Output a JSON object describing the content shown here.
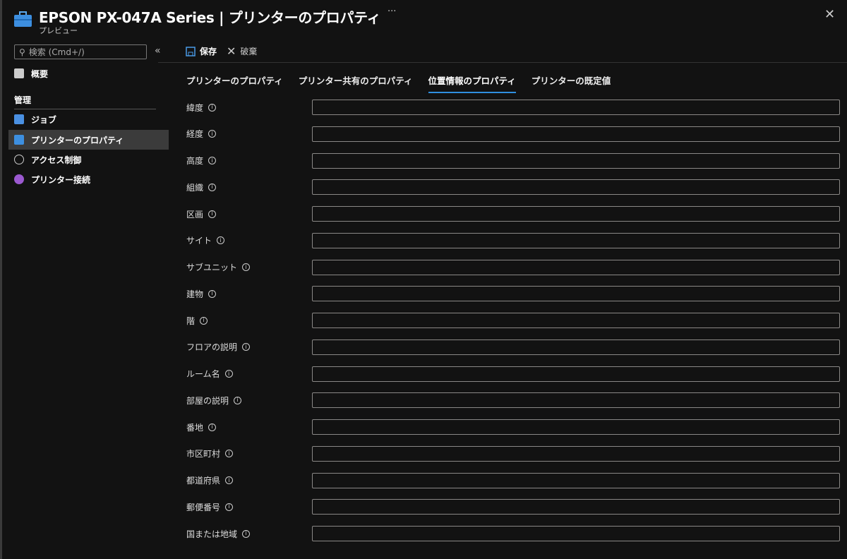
{
  "header": {
    "title": "EPSON PX-047A Series | プリンターのプロパティ",
    "subtitle": "プレビュー",
    "more": "···",
    "close": "✕"
  },
  "sidebar": {
    "search_placeholder": "検索 (Cmd+/)",
    "collapse": "«",
    "overview": "概要",
    "section": "管理",
    "items": [
      {
        "label": "ジョブ"
      },
      {
        "label": "プリンターのプロパティ"
      },
      {
        "label": "アクセス制御"
      },
      {
        "label": "プリンター接続"
      }
    ]
  },
  "toolbar": {
    "save": "保存",
    "discard": "破棄"
  },
  "tabs": [
    {
      "label": "プリンターのプロパティ"
    },
    {
      "label": "プリンター共有のプロパティ"
    },
    {
      "label": "位置情報のプロパティ"
    },
    {
      "label": "プリンターの既定値"
    }
  ],
  "fields": [
    {
      "label": "緯度",
      "value": ""
    },
    {
      "label": "経度",
      "value": ""
    },
    {
      "label": "高度",
      "value": ""
    },
    {
      "label": "組織",
      "value": ""
    },
    {
      "label": "区画",
      "value": ""
    },
    {
      "label": "サイト",
      "value": ""
    },
    {
      "label": "サブユニット",
      "value": ""
    },
    {
      "label": "建物",
      "value": ""
    },
    {
      "label": "階",
      "value": ""
    },
    {
      "label": "フロアの説明",
      "value": ""
    },
    {
      "label": "ルーム名",
      "value": ""
    },
    {
      "label": "部屋の説明",
      "value": ""
    },
    {
      "label": "番地",
      "value": ""
    },
    {
      "label": "市区町村",
      "value": ""
    },
    {
      "label": "都道府県",
      "value": ""
    },
    {
      "label": "郵便番号",
      "value": ""
    },
    {
      "label": "国または地域",
      "value": ""
    }
  ],
  "colors": {
    "accent": "#2f8fe0",
    "selected": "#3b3b3b"
  }
}
